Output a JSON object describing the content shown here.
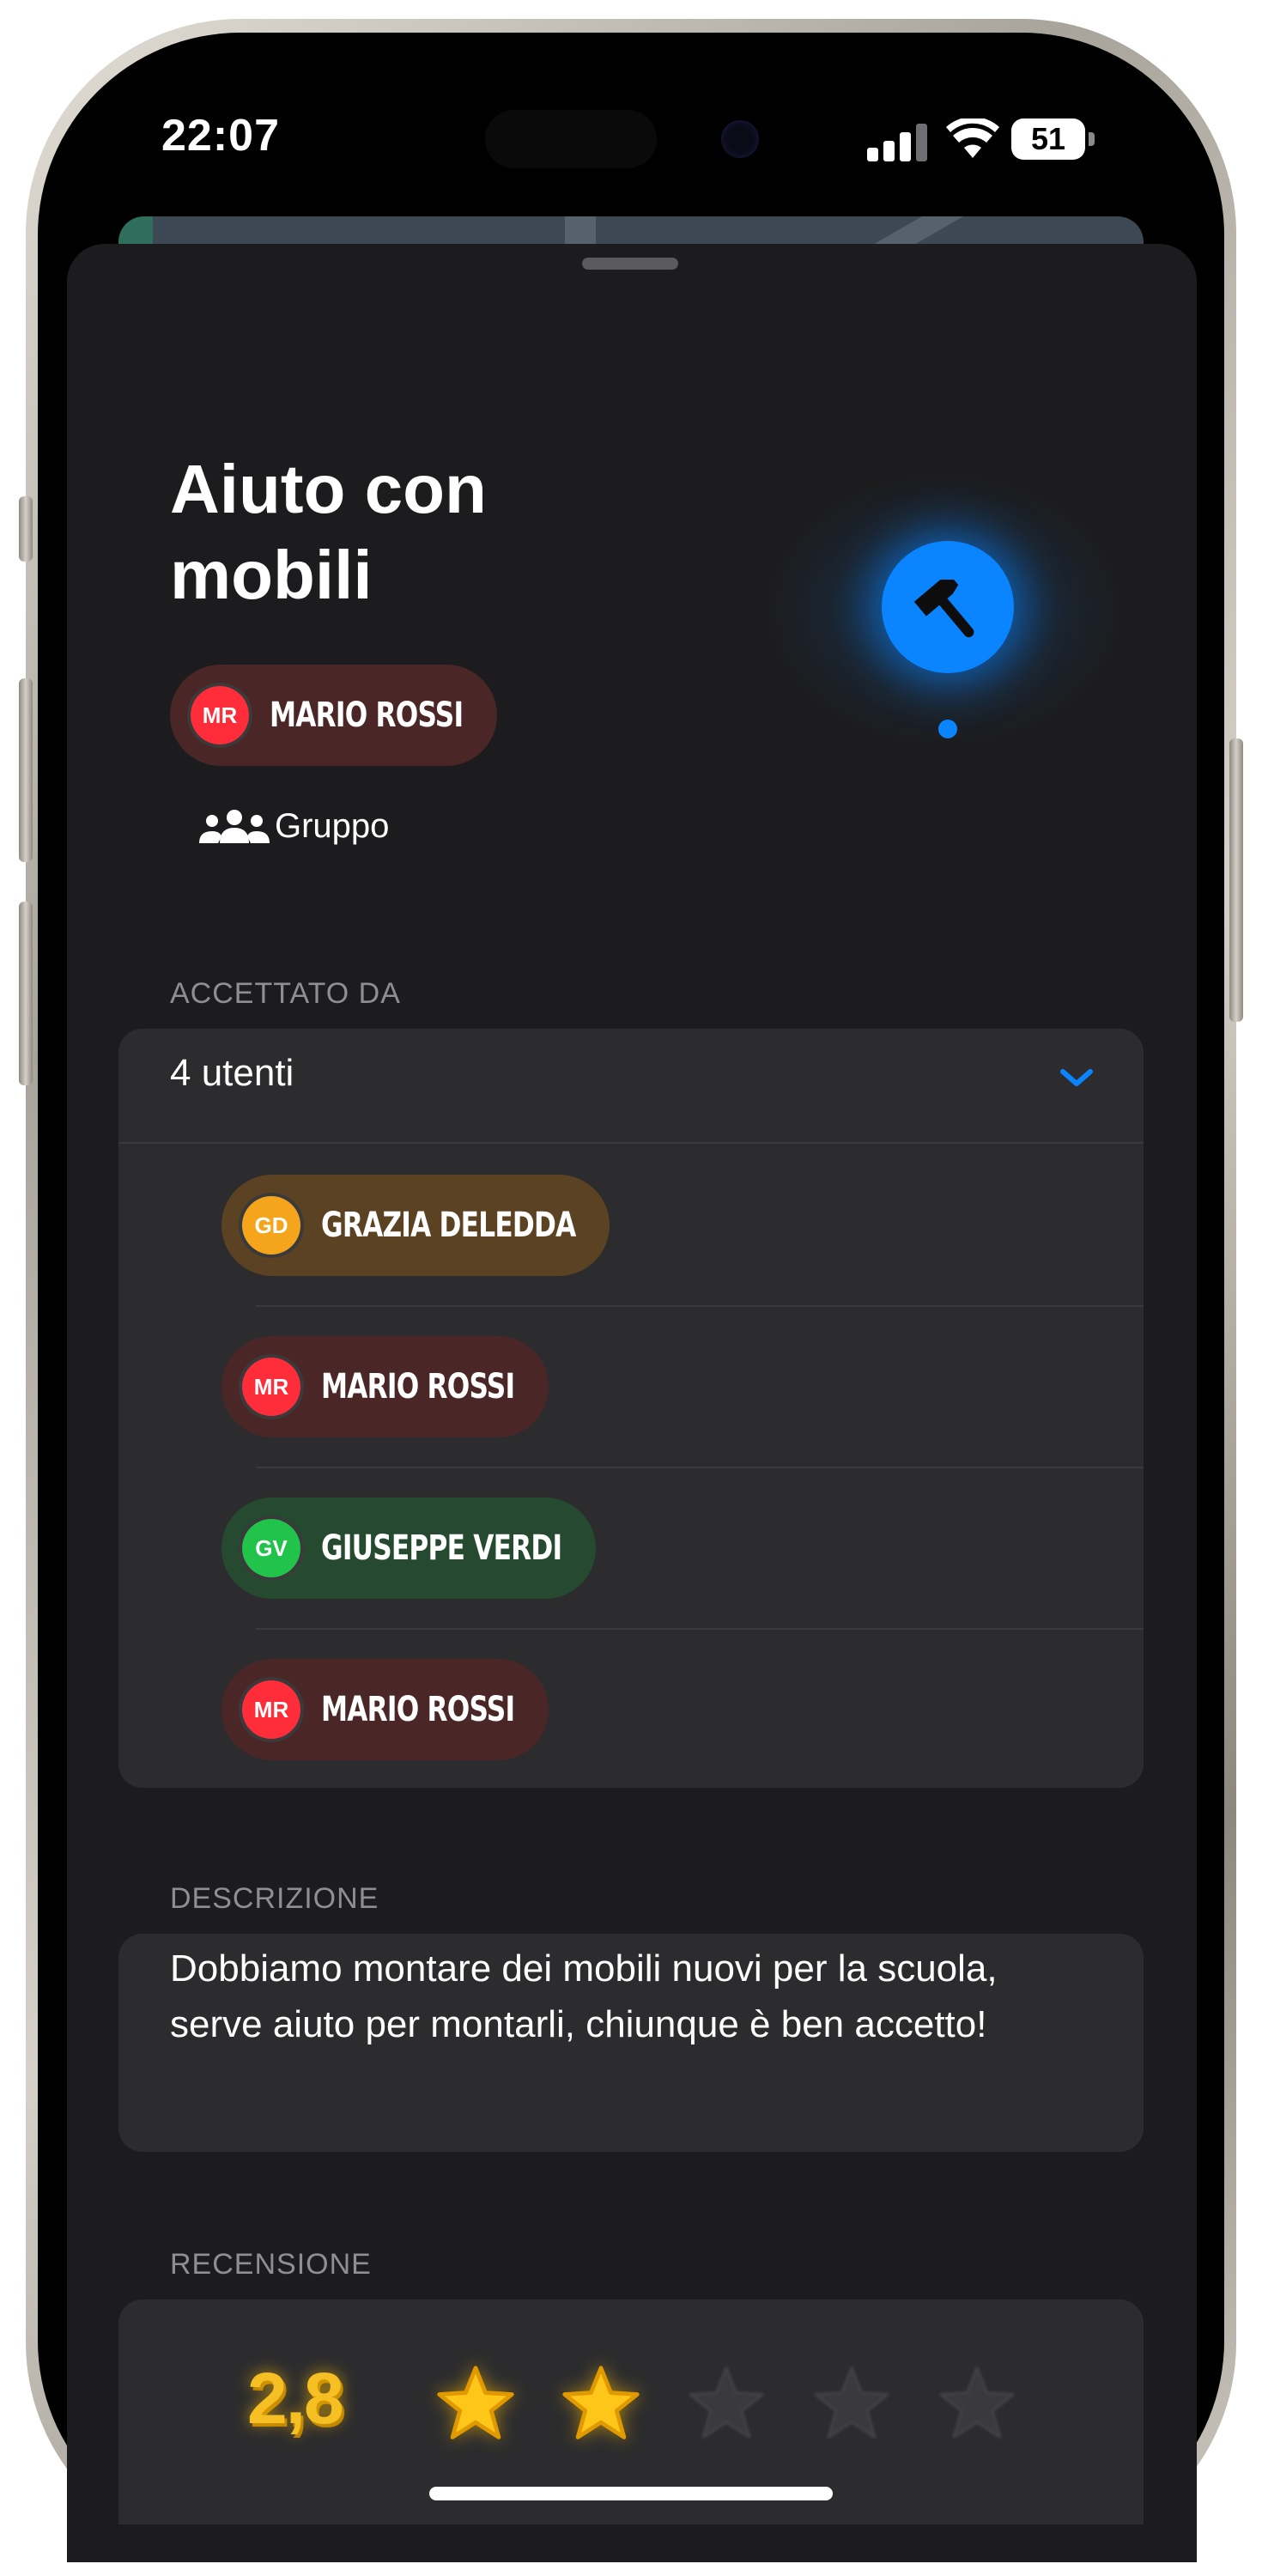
{
  "status_bar": {
    "time": "22:07",
    "battery": "51"
  },
  "request": {
    "title": "Aiuto con mobili",
    "owner": {
      "initials": "MR",
      "name": "MARIO ROSSI"
    },
    "mode_label": "Gruppo",
    "icon": "hammer-icon"
  },
  "accepted": {
    "section_label": "ACCETTATO DA",
    "summary": "4 utenti",
    "users": [
      {
        "initials": "GD",
        "name": "GRAZIA DELEDDA",
        "color": "#f4a51c",
        "chip_color": "#5a4223"
      },
      {
        "initials": "MR",
        "name": "MARIO ROSSI",
        "color": "#ff2d3a",
        "chip_color": "#4a2626"
      },
      {
        "initials": "GV",
        "name": "GIUSEPPE VERDI",
        "color": "#22c34a",
        "chip_color": "#254a30"
      },
      {
        "initials": "MR",
        "name": "MARIO ROSSI",
        "color": "#ff2d3a",
        "chip_color": "#4a2626"
      }
    ]
  },
  "description": {
    "section_label": "DESCRIZIONE",
    "text": "Dobbiamo montare dei mobili nuovi per la scuola, serve aiuto per montarli, chiunque è ben accetto!"
  },
  "review": {
    "section_label": "RECENSIONE",
    "rating": "2,8",
    "stars_filled": 2,
    "stars_total": 5
  },
  "colors": {
    "accent": "#0a84ff",
    "star": "#ffc61a",
    "background": "#1c1c1e",
    "card": "#2c2c2e"
  }
}
